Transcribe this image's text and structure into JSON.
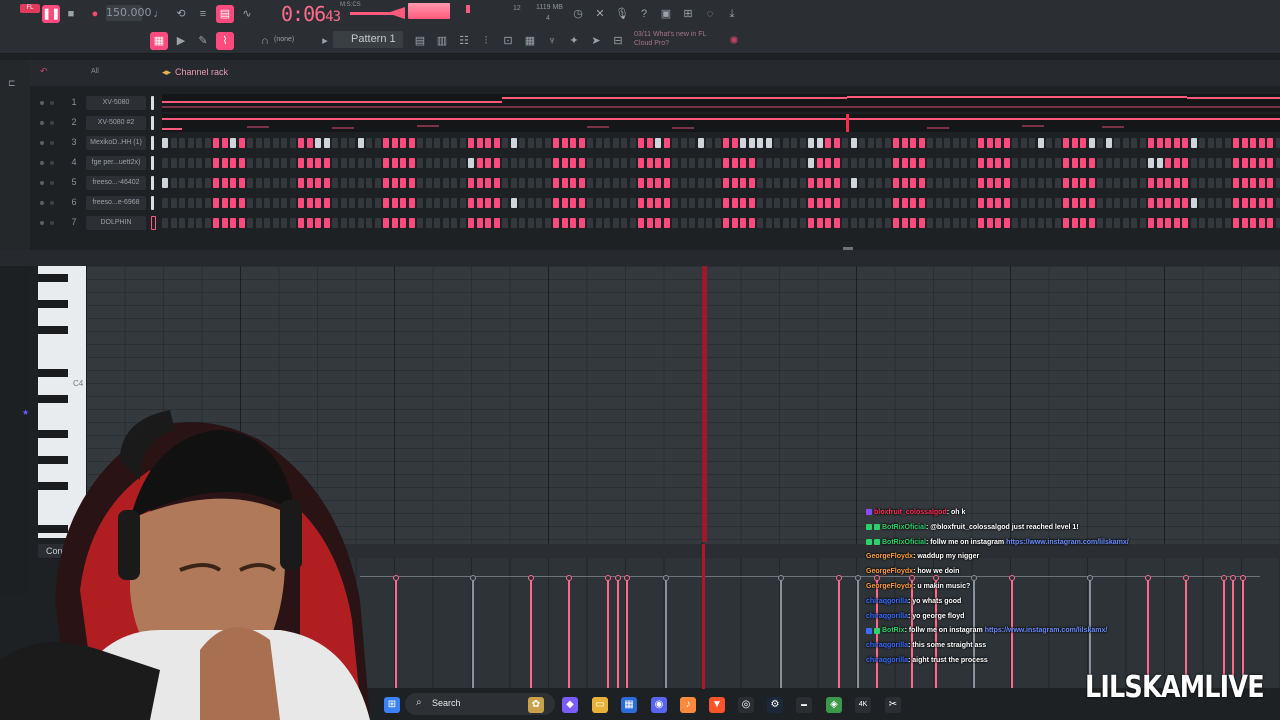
{
  "toolbar": {
    "tempo": "150.000",
    "time_main": "0:06",
    "time_sub": "43",
    "time_unit": "M:S:CS",
    "cpu": "12",
    "memory": "1119 MB",
    "voices": "4",
    "pattern": "Pattern 1",
    "snap": "(none)",
    "news_hint_line1": "03/11  What's new in FL",
    "news_hint_line2": "Cloud Pro?"
  },
  "channel_rack": {
    "title": "Channel rack",
    "filter": "All",
    "channels": [
      {
        "num": "1",
        "name": "XV-5080"
      },
      {
        "num": "2",
        "name": "XV-5080 #2"
      },
      {
        "num": "3",
        "name": "MexikoD..HH (1)"
      },
      {
        "num": "4",
        "name": "fge per...uett2x)"
      },
      {
        "num": "5",
        "name": "freeso...-46402"
      },
      {
        "num": "6",
        "name": "freeso...e-6968"
      },
      {
        "num": "7",
        "name": "DOLPHIN"
      }
    ]
  },
  "piano_roll": {
    "octave_label": "C4",
    "control_label": "Control"
  },
  "chat": [
    {
      "user": "bloxfruit_colossalgod",
      "color": "#ff2a55",
      "msg": ": oh k",
      "badges": [
        "#8a4bff"
      ]
    },
    {
      "user": "BotRixOficial",
      "color": "#2bd16b",
      "msg": ": @bloxfruit_colossalgod just reached level 1!",
      "badges": [
        "#2bd16b",
        "#2bd16b"
      ]
    },
    {
      "user": "BotRixOficial",
      "color": "#2bd16b",
      "msg": ": follw me on instagram ",
      "link": "https://www.instagram.com/lilskamx/",
      "badges": [
        "#2bd16b",
        "#2bd16b"
      ]
    },
    {
      "user": "GeorgeFloydx",
      "color": "#ff9e3d",
      "msg": ": waddup my nigger",
      "badges": []
    },
    {
      "user": "GeorgeFloydx",
      "color": "#ff9e3d",
      "msg": ": how we doin",
      "badges": []
    },
    {
      "user": "GeorgeFloydx",
      "color": "#ff9e3d",
      "msg": ": u makin music?",
      "badges": []
    },
    {
      "user": "chiraqgorilla",
      "color": "#3a6cff",
      "msg": ": yo whats good",
      "badges": []
    },
    {
      "user": "chiraqgorilla",
      "color": "#3a6cff",
      "msg": ": yo george floyd",
      "badges": []
    },
    {
      "user": "BotRix",
      "color": "#2bd16b",
      "msg": ": follw me on instagram ",
      "link": "https://www.instagram.com/lilskamx/",
      "badges": [
        "#3a6cff",
        "#2bd16b"
      ]
    },
    {
      "user": "chiraqgorilla",
      "color": "#3a6cff",
      "msg": ": this some straight ass",
      "badges": []
    },
    {
      "user": "chiraqgorilla",
      "color": "#3a6cff",
      "msg": ": aight trust the process",
      "badges": []
    }
  ],
  "taskbar": {
    "search_label": "Search"
  },
  "watermark": "LILSKAMLIVE",
  "colors": {
    "accent": "#ff4a7d",
    "playhead": "#b3142b"
  }
}
